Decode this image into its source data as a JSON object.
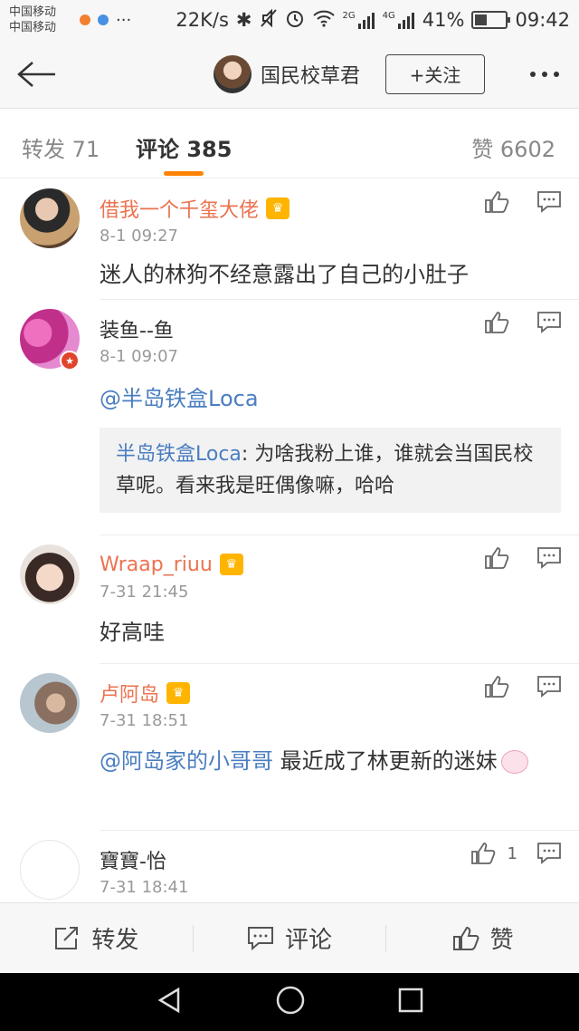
{
  "status_bar": {
    "carrier1": "中国移动",
    "carrier2": "中国移动",
    "dots": "···",
    "net_speed": "22K/s",
    "net_2g": "2G",
    "net_4g": "4G",
    "battery_pct": "41%",
    "battery_level": 0.41,
    "time": "09:42"
  },
  "header": {
    "title": "国民校草君",
    "follow_label": "+关注"
  },
  "tabs": {
    "repost": "转发 71",
    "comments": "评论 385",
    "likes": "赞 6602"
  },
  "comments": [
    {
      "name": "借我一个千玺大佬",
      "vip": true,
      "time": "8-1 09:27",
      "text": "迷人的林狗不经意露出了自己的小肚子"
    },
    {
      "name": "装鱼--鱼",
      "vip": false,
      "time": "8-1 09:07",
      "mention": "@半岛铁盒Loca",
      "quote_author": "半岛铁盒Loca",
      "quote_text": ": 为啥我粉上谁，谁就会当国民校草呢。看来我是旺偶像嘛，哈哈"
    },
    {
      "name": "Wraap_riuu",
      "vip": true,
      "time": "7-31 21:45",
      "text": "好高哇"
    },
    {
      "name": "卢阿岛",
      "vip": true,
      "time": "7-31 18:51",
      "mention": "@阿岛家的小哥哥",
      "text": " 最近成了林更新的迷妹"
    },
    {
      "name": "寶寶-怡",
      "vip": false,
      "time": "7-31 18:41",
      "like_count": "1"
    }
  ],
  "toolbar": {
    "repost": "转发",
    "comment": "评论",
    "like": "赞"
  },
  "colors": {
    "accent": "#ff8200",
    "vip_name": "#eb7350",
    "link": "#4a7ec0"
  }
}
